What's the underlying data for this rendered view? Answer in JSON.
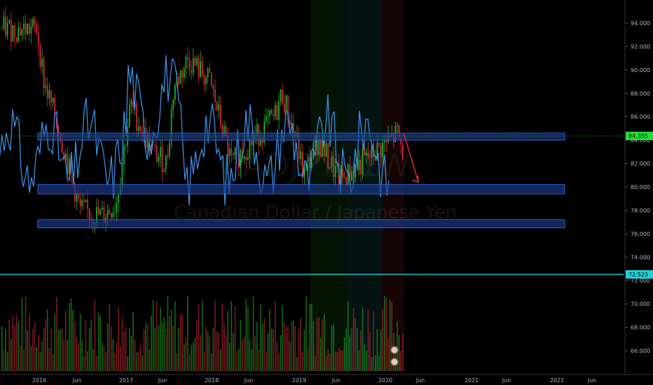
{
  "symbol": "CADJPY, 1W",
  "watermark": {
    "ticker": "CADJPY, 1W",
    "name": "Canadian Dollar / Japanese Yen"
  },
  "colors": {
    "background": "#000000",
    "up": "#26a69a",
    "up_bright": "#22c02a",
    "down": "#e0303a",
    "blue_line": "#3d8fe0",
    "zone_fill": "#1a3a8c",
    "zone_stroke": "#2f5fd0",
    "cyan_line": "#22d0d8",
    "price_badge": "#22e03a",
    "arrow": "#ff2a2a"
  },
  "chart_data": {
    "type": "candlestick",
    "x_ticks": [
      "2016",
      "Jun",
      "2017",
      "Jun",
      "2018",
      "Jun",
      "2019",
      "Jun",
      "2020",
      "Jun",
      "2021",
      "Jun",
      "2022",
      "Jun"
    ],
    "y_ticks": [
      "94.000",
      "92.000",
      "90.000",
      "88.000",
      "86.000",
      "84.000",
      "82.000",
      "80.000",
      "78.000",
      "76.000",
      "74.000",
      "72.000",
      "70.000",
      "68.000",
      "66.000"
    ],
    "ylim": [
      64.5,
      95.5
    ],
    "price_labels": [
      {
        "value": 84.355,
        "text": "84.355"
      },
      {
        "value": 72.523,
        "text": "72.523"
      }
    ],
    "zones": [
      {
        "y_low": 84.0,
        "y_high": 84.6,
        "from": "2015-12",
        "to": "2022-01"
      },
      {
        "y_low": 79.4,
        "y_high": 80.2,
        "from": "2015-12",
        "to": "2022-01"
      },
      {
        "y_low": 76.5,
        "y_high": 77.2,
        "from": "2015-12",
        "to": "2022-01"
      }
    ],
    "arrow": {
      "from_date": "2020-03",
      "from_value": 84.5,
      "to_date": "2020-05",
      "to_value": 80.4
    },
    "candles_sampled": [
      {
        "date": "2015-12",
        "value": 93.5
      },
      {
        "date": "2016-01",
        "value": 89.0
      },
      {
        "date": "2016-03",
        "value": 85.0
      },
      {
        "date": "2016-06",
        "value": 78.0
      },
      {
        "date": "2016-09",
        "value": 77.5
      },
      {
        "date": "2016-11",
        "value": 78.5
      },
      {
        "date": "2017-01",
        "value": 87.0
      },
      {
        "date": "2017-04",
        "value": 83.0
      },
      {
        "date": "2017-06",
        "value": 82.0
      },
      {
        "date": "2017-07",
        "value": 88.5
      },
      {
        "date": "2017-09",
        "value": 91.0
      },
      {
        "date": "2017-12",
        "value": 89.0
      },
      {
        "date": "2018-03",
        "value": 82.0
      },
      {
        "date": "2018-06",
        "value": 84.0
      },
      {
        "date": "2018-09",
        "value": 86.0
      },
      {
        "date": "2018-10",
        "value": 88.0
      },
      {
        "date": "2018-12",
        "value": 84.0
      },
      {
        "date": "2019-01",
        "value": 81.0
      },
      {
        "date": "2019-03",
        "value": 84.0
      },
      {
        "date": "2019-06",
        "value": 80.5
      },
      {
        "date": "2019-09",
        "value": 82.0
      },
      {
        "date": "2019-12",
        "value": 83.5
      },
      {
        "date": "2020-02",
        "value": 84.5
      },
      {
        "date": "2020-03",
        "value": 82.5
      }
    ],
    "volume_relative": [
      0.25,
      0.45,
      0.35,
      0.3,
      0.55,
      0.4,
      0.3,
      0.6,
      0.35,
      0.4,
      0.3,
      0.45,
      0.35,
      0.3,
      0.5,
      0.4,
      0.35,
      0.3,
      0.45,
      0.35,
      0.6,
      0.4,
      0.3,
      0.25
    ]
  }
}
